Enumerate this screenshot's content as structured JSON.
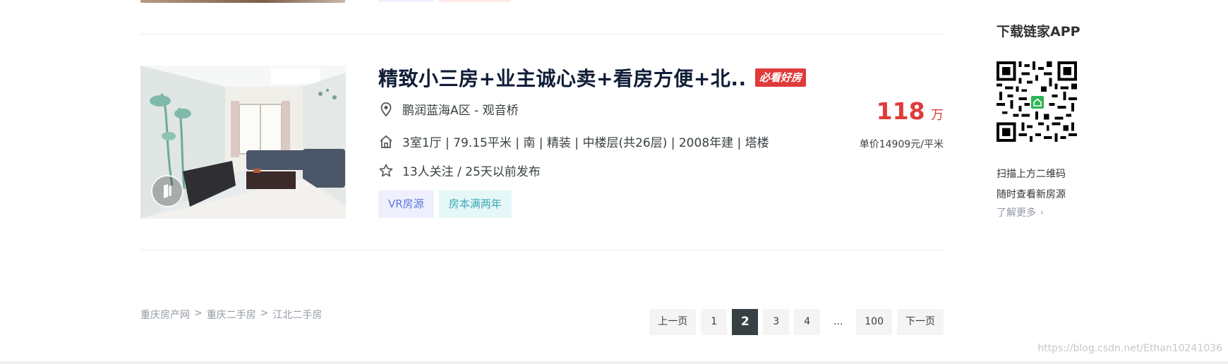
{
  "listing": {
    "title": "精致小三房+业主诚心卖+看房方便+北...",
    "badge": "必看好房",
    "location": "鹏润蓝海A区 - 观音桥",
    "house_info": "3室1厅 | 79.15平米 | 南 | 精装 | 中楼层(共26层) | 2008年建 | 塔楼",
    "follow_info": "13人关注 / 25天以前发布",
    "tags": [
      "VR房源",
      "房本满两年"
    ],
    "price": "118",
    "price_unit": "万",
    "unit_price": "单价14909元/平米"
  },
  "breadcrumb": {
    "items": [
      "重庆房产网",
      "重庆二手房",
      "江北二手房"
    ],
    "separator": ">"
  },
  "pagination": {
    "prev": "上一页",
    "pages": [
      "1",
      "2",
      "3",
      "4"
    ],
    "active": "2",
    "ellipsis": "...",
    "last": "100",
    "next": "下一页"
  },
  "sidebar": {
    "title": "下载链家APP",
    "line1": "扫描上方二维码",
    "line2": "随时查看新房源",
    "more": "了解更多"
  },
  "watermark": "https://blog.csdn.net/Ethan10241036",
  "colors": {
    "accent_red": "#e03b3b",
    "title": "#101d37",
    "text": "#394043",
    "muted": "#9399a5",
    "tag_vr_bg": "#eef1fd",
    "tag_vr_text": "#5b77e0",
    "tag_two_bg": "#e6f7f8",
    "tag_two_text": "#3aa9b3",
    "pager_active": "#394043"
  },
  "icons": {
    "location": "location-pin-icon",
    "house": "house-icon",
    "follow": "star-icon",
    "vr": "vr-badge-icon",
    "more": "chevron-right-icon"
  }
}
